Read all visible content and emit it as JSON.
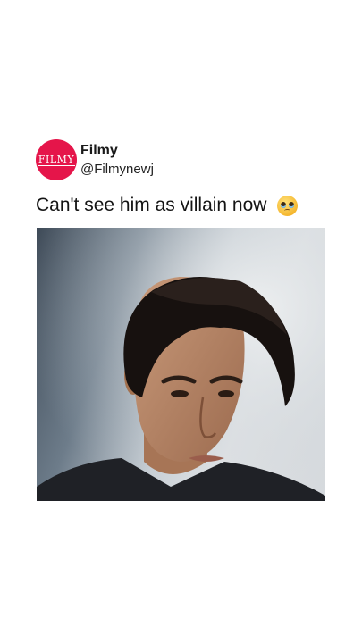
{
  "post": {
    "avatar_text": "FILMY",
    "display_name": "Filmy",
    "handle": "@Filmynewj",
    "caption": "Can't see him as villain now",
    "emoji_icon": "pleading-face-icon",
    "brand_color": "#e5154a"
  }
}
